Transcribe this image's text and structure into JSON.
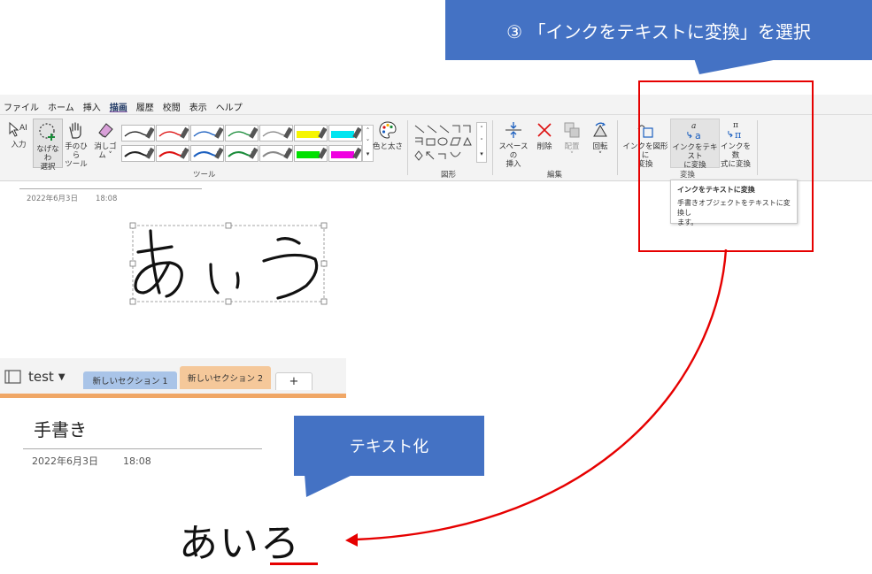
{
  "callouts": {
    "step": "③ 「インクをテキストに変換」を選択",
    "result": "テキスト化"
  },
  "menu": [
    "ファイル",
    "ホーム",
    "挿入",
    "描画",
    "履歴",
    "校閲",
    "表示",
    "ヘルプ"
  ],
  "ribbon": {
    "input": "入力",
    "lasso_1": "なげなわ",
    "lasso_2": "選択",
    "hand_1": "手のひら",
    "hand_2": "ツール",
    "eraser_1": "消しゴ",
    "eraser_2": "ム",
    "color_size": "色と太さ",
    "space_1": "スペースの",
    "space_2": "挿入",
    "delete": "削除",
    "arrange": "配置",
    "rotate": "回転",
    "ink_shape_1": "インクを図形に",
    "ink_shape_2": "変換",
    "ink_text_1": "インクをテキスト",
    "ink_text_2": "に変換",
    "ink_math_1": "インクを数",
    "ink_math_2": "式に変換",
    "groups": {
      "tools": "ツール",
      "shapes": "図形",
      "edit": "編集",
      "convert": "変換"
    }
  },
  "tooltip": {
    "title": "インクをテキストに変換",
    "desc_1": "手書きオブジェクトをテキストに変換し",
    "desc_2": "ます。"
  },
  "upper_page": {
    "date": "2022年6月3日",
    "time": "18:08"
  },
  "notebook": {
    "name": "test",
    "tabs": [
      "新しいセクション 1",
      "新しいセクション 2"
    ],
    "add": "+"
  },
  "page": {
    "title": "手書き",
    "date": "2022年6月3日",
    "time": "18:08",
    "result_text": "あいろ"
  },
  "colors": {
    "callout": "#4472c4",
    "highlight": "#e60000",
    "section1": "#a9c4e8",
    "section2": "#f5c89a"
  }
}
